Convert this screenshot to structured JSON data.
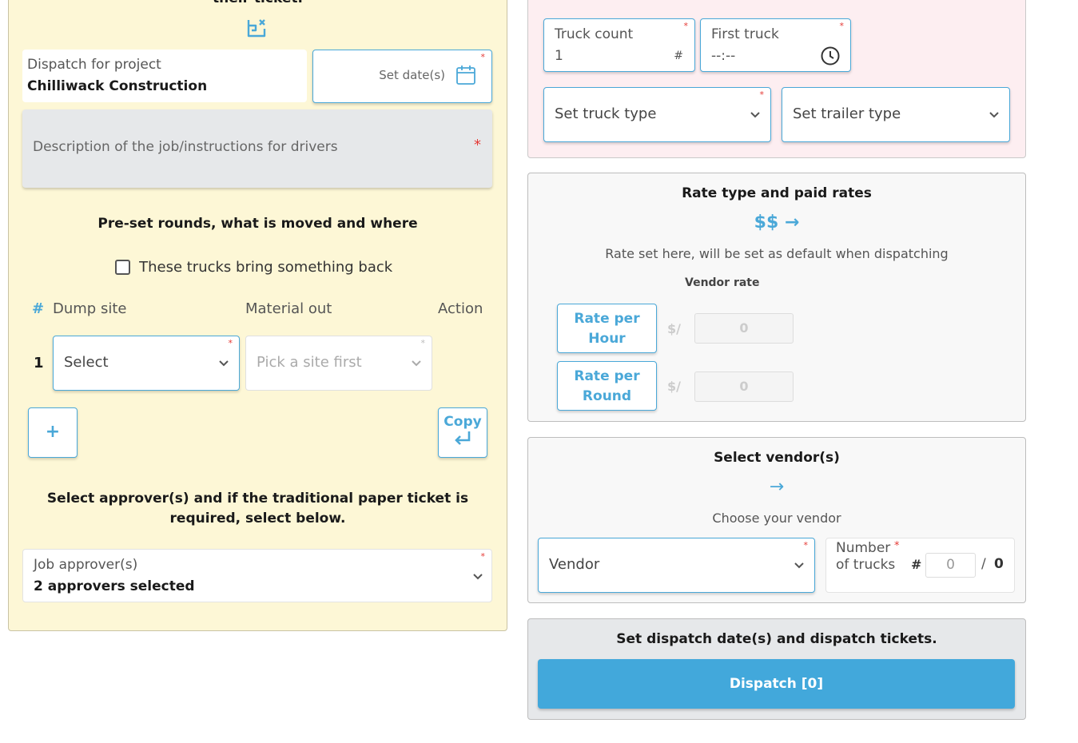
{
  "job": {
    "truncated_title": "their ticket.",
    "project_label": "Dispatch for project",
    "project_name": "Chilliwack Construction",
    "date_placeholder": "Set date(s)",
    "description_placeholder": "Description of the job/instructions for drivers",
    "required_mark": "*"
  },
  "rounds": {
    "heading": "Pre-set rounds, what is moved and where",
    "bring_back_label": "These trucks bring something back",
    "bring_back_checked": false,
    "columns": {
      "hash": "#",
      "dump_site": "Dump site",
      "material_out": "Material out",
      "action": "Action"
    },
    "row_number": "1",
    "dump_site_value": "Select",
    "material_placeholder": "Pick a site first",
    "add_label": "+",
    "copy_label": "Copy"
  },
  "approvers": {
    "heading": "Select approver(s) and if the traditional paper ticket is required, select below.",
    "label": "Job approver(s)",
    "value": "2 approvers selected"
  },
  "trucks": {
    "count_label": "Truck count",
    "count_value": "1",
    "count_hash": "#",
    "first_truck_label": "First truck",
    "first_truck_value": "--:--",
    "truck_type_placeholder": "Set truck type",
    "trailer_type_placeholder": "Set trailer type"
  },
  "rates": {
    "heading": "Rate type and paid rates",
    "symbol": "$$ →",
    "description": "Rate set here, will be set as default when dispatching",
    "vendor_rate_label": "Vendor rate",
    "per_hour_label": "Rate per Hour",
    "per_round_label": "Rate per Round",
    "unit_prefix": "$/",
    "per_hour_value": "0",
    "per_round_value": "0"
  },
  "vendors": {
    "heading": "Select vendor(s)",
    "arrow": "→",
    "description": "Choose your vendor",
    "vendor_placeholder": "Vendor",
    "num_trucks_label": "Number of trucks",
    "num_hash": "#",
    "num_value": "0",
    "num_slash": "/",
    "num_total": "0"
  },
  "dispatch": {
    "heading": "Set dispatch date(s) and dispatch tickets.",
    "button_label": "Dispatch [0]"
  },
  "colors": {
    "accent": "#42a8db",
    "left_panel_bg": "#fdf7d6",
    "truck_panel_bg": "#fdeef1",
    "required": "#e53935"
  }
}
